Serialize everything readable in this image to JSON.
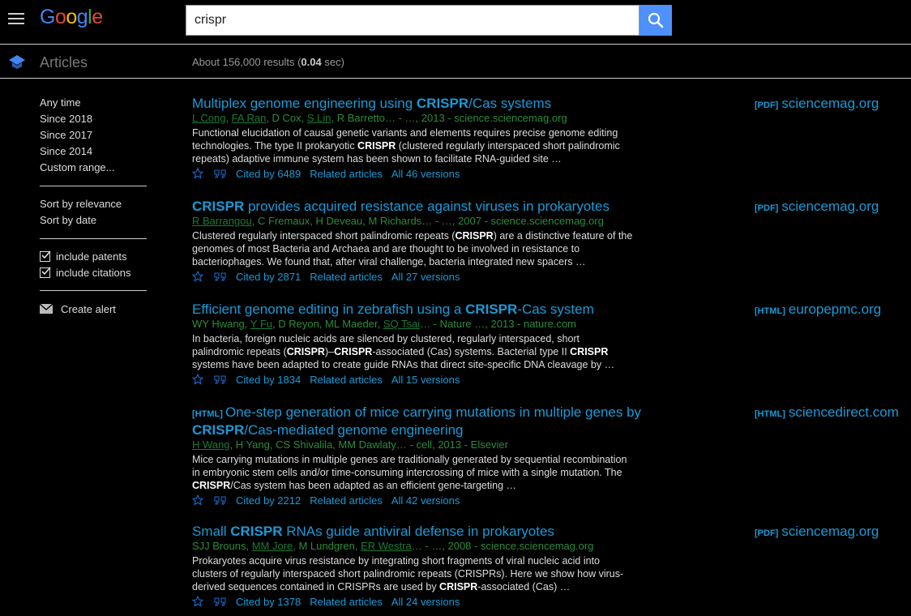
{
  "header": {
    "logo_letters": [
      {
        "ch": "G",
        "color": "#4285f4"
      },
      {
        "ch": "o",
        "color": "#ea4335"
      },
      {
        "ch": "o",
        "color": "#fbbc05"
      },
      {
        "ch": "g",
        "color": "#4285f4"
      },
      {
        "ch": "l",
        "color": "#34a853"
      },
      {
        "ch": "e",
        "color": "#ea4335"
      }
    ],
    "search_value": "crispr"
  },
  "subheader": {
    "section": "Articles",
    "stats_prefix": "About 156,000 results (",
    "stats_time": "0.04",
    "stats_suffix": " sec)"
  },
  "sidebar": {
    "time": [
      "Any time",
      "Since 2018",
      "Since 2017",
      "Since 2014",
      "Custom range..."
    ],
    "sort": [
      "Sort by relevance",
      "Sort by date"
    ],
    "include": [
      "include patents",
      "include citations"
    ],
    "alert": "Create alert"
  },
  "results": [
    {
      "tag": "",
      "title": [
        {
          "t": "Multiplex genome engineering using "
        },
        {
          "t": "CRISPR",
          "b": true
        },
        {
          "t": "/Cas systems"
        }
      ],
      "meta": [
        {
          "t": "L Cong",
          "u": true
        },
        {
          "t": ", "
        },
        {
          "t": "FA Ran",
          "u": true
        },
        {
          "t": ", D Cox, "
        },
        {
          "t": "S Lin",
          "u": true
        },
        {
          "t": ", R Barretto… - …, 2013 - science.sciencemag.org"
        }
      ],
      "snippet": [
        {
          "t": "Functional elucidation of causal genetic variants and elements requires precise genome editing technologies. The type II prokaryotic "
        },
        {
          "t": "CRISPR",
          "b": true
        },
        {
          "t": " (clustered regularly interspaced short palindromic repeats) adaptive immune system has been shown to facilitate RNA-guided site …"
        }
      ],
      "cited": "Cited by 6489",
      "related": "Related articles",
      "versions": "All 46 versions",
      "side_tag": "[PDF]",
      "side_domain": "sciencemag.org"
    },
    {
      "tag": "",
      "title": [
        {
          "t": "CRISPR",
          "b": true
        },
        {
          "t": " provides acquired resistance against viruses in prokaryotes"
        }
      ],
      "meta": [
        {
          "t": "R Barrangou",
          "u": true
        },
        {
          "t": ", C Fremaux, H Deveau, M Richards… - …, 2007 - science.sciencemag.org"
        }
      ],
      "snippet": [
        {
          "t": "Clustered regularly interspaced short palindromic repeats ("
        },
        {
          "t": "CRISPR",
          "b": true
        },
        {
          "t": ") are a distinctive feature of the genomes of most Bacteria and Archaea and are thought to be involved in resistance to bacteriophages. We found that, after viral challenge, bacteria integrated new spacers …"
        }
      ],
      "cited": "Cited by 2871",
      "related": "Related articles",
      "versions": "All 27 versions",
      "side_tag": "[PDF]",
      "side_domain": "sciencemag.org"
    },
    {
      "tag": "",
      "title": [
        {
          "t": "Efficient genome editing in zebrafish using a "
        },
        {
          "t": "CRISPR",
          "b": true
        },
        {
          "t": "-Cas system"
        }
      ],
      "meta": [
        {
          "t": "WY Hwang, "
        },
        {
          "t": "Y Fu",
          "u": true
        },
        {
          "t": ", D Reyon, ML Maeder, "
        },
        {
          "t": "SQ Tsai",
          "u": true
        },
        {
          "t": "… - Nature …, 2013 - nature.com"
        }
      ],
      "snippet": [
        {
          "t": "In bacteria, foreign nucleic acids are silenced by clustered, regularly interspaced, short palindromic repeats ("
        },
        {
          "t": "CRISPR",
          "b": true
        },
        {
          "t": ")–"
        },
        {
          "t": "CRISPR",
          "b": true
        },
        {
          "t": "-associated (Cas) systems. Bacterial type II "
        },
        {
          "t": "CRISPR",
          "b": true
        },
        {
          "t": " systems have been adapted to create guide RNAs that direct site-specific DNA cleavage by …"
        }
      ],
      "cited": "Cited by 1834",
      "related": "Related articles",
      "versions": "All 15 versions",
      "side_tag": "[HTML]",
      "side_domain": "europepmc.org"
    },
    {
      "tag": "[HTML]",
      "title": [
        {
          "t": "One-step generation of mice carrying mutations in multiple genes by "
        },
        {
          "t": "CRISPR",
          "b": true
        },
        {
          "t": "/Cas-mediated genome engineering"
        }
      ],
      "meta": [
        {
          "t": "H Wang",
          "u": true
        },
        {
          "t": ", H Yang, CS Shivalila, MM Dawlaty… - cell, 2013 - Elsevier"
        }
      ],
      "snippet": [
        {
          "t": "Mice carrying mutations in multiple genes are traditionally generated by sequential recombination in embryonic stem cells and/or time-consuming intercrossing of mice with a single mutation. The "
        },
        {
          "t": "CRISPR",
          "b": true
        },
        {
          "t": "/Cas system has been adapted as an efficient gene-targeting …"
        }
      ],
      "cited": "Cited by 2212",
      "related": "Related articles",
      "versions": "All 42 versions",
      "side_tag": "[HTML]",
      "side_domain": "sciencedirect.com"
    },
    {
      "tag": "",
      "title": [
        {
          "t": "Small "
        },
        {
          "t": "CRISPR",
          "b": true
        },
        {
          "t": " RNAs guide antiviral defense in prokaryotes"
        }
      ],
      "meta": [
        {
          "t": "SJJ Brouns, "
        },
        {
          "t": "MM Jore",
          "u": true
        },
        {
          "t": ", M Lundgren, "
        },
        {
          "t": "ER Westra",
          "u": true
        },
        {
          "t": "… - …, 2008 - science.sciencemag.org"
        }
      ],
      "snippet": [
        {
          "t": "Prokaryotes acquire virus resistance by integrating short fragments of viral nucleic acid into clusters of regularly interspaced short palindromic repeats (CRISPRs). Here we show how virus-derived sequences contained in CRISPRs are used by "
        },
        {
          "t": "CRISPR",
          "b": true
        },
        {
          "t": "-associated (Cas) …"
        }
      ],
      "cited": "Cited by 1378",
      "related": "Related articles",
      "versions": "All 24 versions",
      "side_tag": "[PDF]",
      "side_domain": "sciencemag.org"
    }
  ]
}
